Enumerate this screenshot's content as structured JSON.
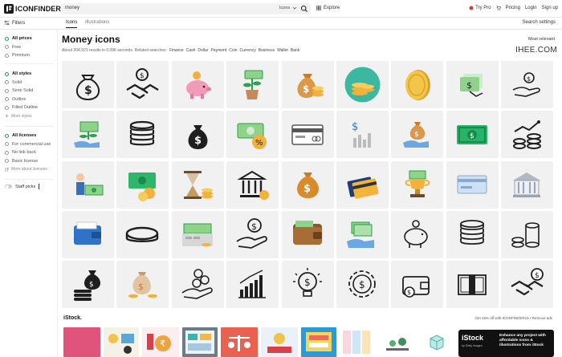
{
  "app": {
    "logo_text": "ICONFINDER",
    "brand_color": "#1a1a1a",
    "accent_color": "#2e9e4f"
  },
  "search": {
    "value": "money",
    "scope": "Icons",
    "icon": "search-icon"
  },
  "topnav": {
    "explore": "Explore",
    "try_pro": "Try Pro",
    "pricing": "Pricing",
    "login": "Login",
    "signup": "Sign up"
  },
  "subbar": {
    "filters_label": "Filters",
    "tabs": [
      {
        "label": "Icons",
        "active": true
      },
      {
        "label": "Illustrations",
        "active": false
      }
    ],
    "search_settings": "Search settings"
  },
  "sidebar": {
    "price": [
      {
        "label": "All prices",
        "selected": true
      },
      {
        "label": "Free",
        "selected": false
      },
      {
        "label": "Premium",
        "selected": false
      }
    ],
    "styles": [
      {
        "label": "All styles",
        "selected": true
      },
      {
        "label": "Solid",
        "selected": false
      },
      {
        "label": "Semi Solid",
        "selected": false
      },
      {
        "label": "Outline",
        "selected": false
      },
      {
        "label": "Filled Outline",
        "selected": false
      }
    ],
    "more_styles": "More styles",
    "licenses": [
      {
        "label": "All licenses",
        "selected": true
      },
      {
        "label": "For commercial use",
        "selected": false
      },
      {
        "label": "No link back",
        "selected": false
      },
      {
        "label": "Basic license",
        "selected": false
      }
    ],
    "more_licenses": "More about licenses",
    "staff_picks": "Staff picks",
    "staff_picks_on": false
  },
  "main": {
    "title": "Money icons",
    "result_text": "About 204,921 results in 0.096 seconds. Related searches:",
    "related": [
      "Finance",
      "Cash",
      "Dollar",
      "Payment",
      "Coin",
      "Currency",
      "Business",
      "Wallet",
      "Bank"
    ],
    "sort": "Most relevant",
    "watermark": "IHEE.COM"
  },
  "icons": [
    [
      "money-bag-icon",
      "hand-dollar-coin-icon",
      "piggy-bank-icon",
      "money-plant-icon",
      "money-bag-coins-icon",
      "gold-coins-stack-icon",
      "gold-coin-icon",
      "cash-stack-icon",
      "hand-coin-icon"
    ],
    [
      "money-growth-hand-icon",
      "coin-stack-icon",
      "dollar-bag-icon",
      "banknote-percent-icon",
      "credit-card-icon",
      "dollar-chart-icon",
      "hand-money-bag-icon",
      "banknote-icon",
      "coins-growth-icon"
    ],
    [
      "businessman-money-icon",
      "cash-coins-icon",
      "hourglass-coins-icon",
      "bank-building-icon",
      "money-sack-icon",
      "credit-cards-icon",
      "trophy-money-icon",
      "card-payment-icon",
      "bank-icon"
    ],
    [
      "wallet-icon",
      "single-coin-icon",
      "cash-register-icon",
      "hand-dollar-icon",
      "leather-wallet-icon",
      "hand-cash-icon",
      "piggy-bank-outline-icon",
      "coin-stack-outline-icon",
      "coins-tower-icon"
    ],
    [
      "money-bag-stack-icon",
      "sack-coins-icon",
      "hand-coins-icon",
      "bar-chart-dollar-icon",
      "bulb-dollar-icon",
      "gear-dollar-icon",
      "wallet-card-icon",
      "cash-bundle-icon",
      "handshake-dollar-icon"
    ]
  ],
  "ad": {
    "brand": "iStock.",
    "promo": "Get 15% off with ICONFINDER15 • Remove ads",
    "card_logo": "iStock",
    "card_sub": "by Getty Images",
    "card_text": "Enhance any project with affordable icons & illustrations from iStock"
  }
}
